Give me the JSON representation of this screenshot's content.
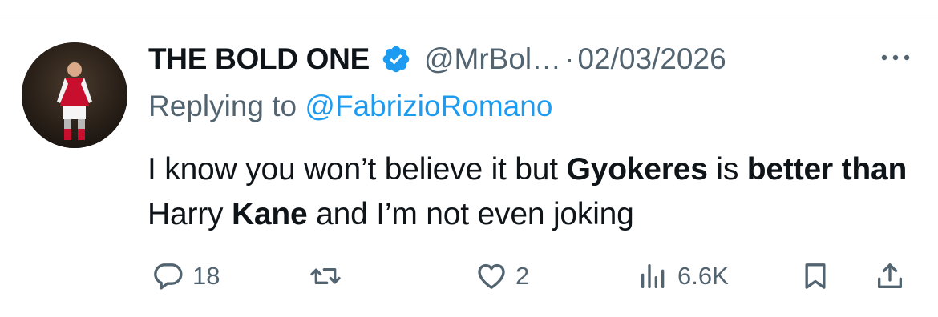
{
  "tweet": {
    "author": {
      "display_name": "THE BOLD ONE",
      "handle": "@MrBol…",
      "verified": true,
      "avatar_icon": "player-avatar"
    },
    "separator": "·",
    "date": "02/03/2026",
    "reply": {
      "prefix": "Replying to ",
      "mention": "@FabrizioRomano"
    },
    "text_segments": [
      {
        "text": "I know you won’t believe it but ",
        "bold": false
      },
      {
        "text": "Gyokeres",
        "bold": true
      },
      {
        "text": " is ",
        "bold": false
      },
      {
        "text": "better than",
        "bold": true
      },
      {
        "text": " Harry ",
        "bold": false
      },
      {
        "text": "Kane",
        "bold": true
      },
      {
        "text": " and I’m not even joking",
        "bold": false
      }
    ],
    "actions": {
      "reply_count": "18",
      "retweet_count": "",
      "like_count": "2",
      "views_count": "6.6K"
    }
  },
  "colors": {
    "text_primary": "#0f1419",
    "text_secondary": "#536471",
    "mention": "#1d9bf0",
    "verified_badge": "#1d9bf0"
  }
}
